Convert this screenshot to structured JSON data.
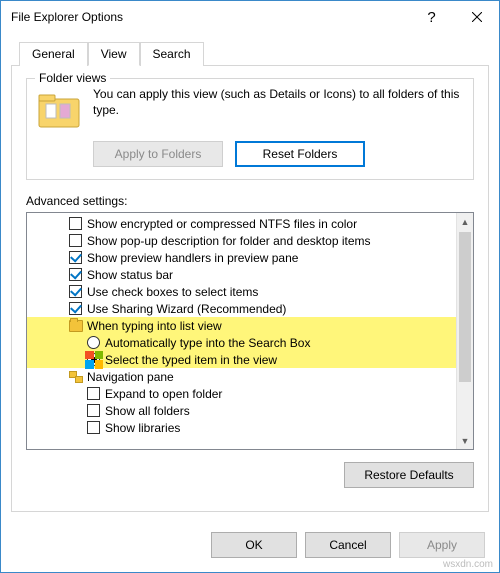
{
  "window": {
    "title": "File Explorer Options"
  },
  "tabs": {
    "general": "General",
    "view": "View",
    "search": "Search",
    "active": "view"
  },
  "folderViews": {
    "legend": "Folder views",
    "description": "You can apply this view (such as Details or Icons) to all folders of this type.",
    "applyBtn": "Apply to Folders",
    "resetBtn": "Reset Folders"
  },
  "advanced": {
    "label": "Advanced settings:",
    "items": [
      {
        "type": "check",
        "checked": false,
        "label": "Show encrypted or compressed NTFS files in color"
      },
      {
        "type": "check",
        "checked": false,
        "label": "Show pop-up description for folder and desktop items"
      },
      {
        "type": "check",
        "checked": true,
        "label": "Show preview handlers in preview pane"
      },
      {
        "type": "check",
        "checked": true,
        "label": "Show status bar"
      },
      {
        "type": "check",
        "checked": true,
        "label": "Use check boxes to select items"
      },
      {
        "type": "check",
        "checked": true,
        "label": "Use Sharing Wizard (Recommended)"
      },
      {
        "type": "folder",
        "label": "When typing into list view",
        "highlight": true
      },
      {
        "type": "radio",
        "selected": false,
        "label": "Automatically type into the Search Box",
        "highlight": true,
        "indent": 1
      },
      {
        "type": "radio",
        "selected": true,
        "label": "Select the typed item in the view",
        "highlight": true,
        "indent": 1
      },
      {
        "type": "nav",
        "label": "Navigation pane"
      },
      {
        "type": "check",
        "checked": false,
        "label": "Expand to open folder",
        "indent": 1
      },
      {
        "type": "check",
        "checked": false,
        "label": "Show all folders",
        "indent": 1
      },
      {
        "type": "check",
        "checked": false,
        "label": "Show libraries",
        "indent": 1
      }
    ]
  },
  "restoreDefaults": "Restore Defaults",
  "buttons": {
    "ok": "OK",
    "cancel": "Cancel",
    "apply": "Apply"
  },
  "watermark": "wsxdn.com"
}
